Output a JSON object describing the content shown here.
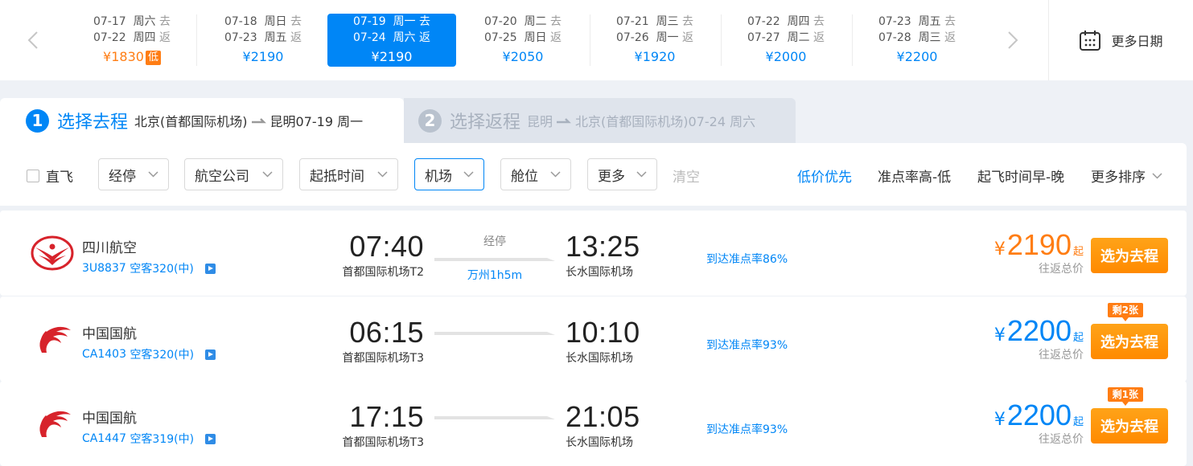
{
  "date_strip": {
    "items": [
      {
        "go_date": "07-17",
        "go_weekday": "周六",
        "go_dir": "去",
        "back_date": "07-22",
        "back_weekday": "周四",
        "back_dir": "返",
        "price": "¥1830",
        "low_tag": "低"
      },
      {
        "go_date": "07-18",
        "go_weekday": "周日",
        "go_dir": "去",
        "back_date": "07-23",
        "back_weekday": "周五",
        "back_dir": "返",
        "price": "¥2190"
      },
      {
        "go_date": "07-19",
        "go_weekday": "周一",
        "go_dir": "去",
        "back_date": "07-24",
        "back_weekday": "周六",
        "back_dir": "返",
        "price": "¥2190",
        "selected": true
      },
      {
        "go_date": "07-20",
        "go_weekday": "周二",
        "go_dir": "去",
        "back_date": "07-25",
        "back_weekday": "周日",
        "back_dir": "返",
        "price": "¥2050"
      },
      {
        "go_date": "07-21",
        "go_weekday": "周三",
        "go_dir": "去",
        "back_date": "07-26",
        "back_weekday": "周一",
        "back_dir": "返",
        "price": "¥1920"
      },
      {
        "go_date": "07-22",
        "go_weekday": "周四",
        "go_dir": "去",
        "back_date": "07-27",
        "back_weekday": "周二",
        "back_dir": "返",
        "price": "¥2000"
      },
      {
        "go_date": "07-23",
        "go_weekday": "周五",
        "go_dir": "去",
        "back_date": "07-28",
        "back_weekday": "周三",
        "back_dir": "返",
        "price": "¥2200"
      }
    ],
    "more_dates_label": "更多日期"
  },
  "steps": {
    "go": {
      "num": "1",
      "title": "选择去程",
      "from": "北京(首都国际机场)",
      "to": "昆明07-19 周一"
    },
    "back": {
      "num": "2",
      "title": "选择返程",
      "from": "昆明",
      "to": "北京(首都国际机场)07-24 周六"
    }
  },
  "filters": {
    "direct_label": "直飞",
    "buttons": [
      "经停",
      "航空公司",
      "起抵时间",
      "机场",
      "舱位",
      "更多"
    ],
    "active_button": "机场",
    "clear_label": "清空",
    "sorts": [
      "低价优先",
      "准点率高-低",
      "起飞时间早-晚",
      "更多排序"
    ],
    "active_sort": "低价优先"
  },
  "flights": [
    {
      "airline": "四川航空",
      "flight_no": "3U8837",
      "aircraft": "空客320(中)",
      "dep_time": "07:40",
      "dep_airport": "首都国际机场T2",
      "arr_time": "13:25",
      "arr_airport": "长水国际机场",
      "stop_label": "经停",
      "stop_city": "万州1h5m",
      "ontime": "到达准点率86%",
      "price_yen": "¥",
      "price": "2190",
      "price_qi": "起",
      "price_sub": "往返总价",
      "select_label": "选为去程"
    },
    {
      "airline": "中国国航",
      "flight_no": "CA1403",
      "aircraft": "空客320(中)",
      "dep_time": "06:15",
      "dep_airport": "首都国际机场T3",
      "arr_time": "10:10",
      "arr_airport": "长水国际机场",
      "ontime": "到达准点率93%",
      "price_yen": "¥",
      "price": "2200",
      "price_qi": "起",
      "price_sub": "往返总价",
      "remain": "剩2张",
      "select_label": "选为去程"
    },
    {
      "airline": "中国国航",
      "flight_no": "CA1447",
      "aircraft": "空客319(中)",
      "dep_time": "17:15",
      "dep_airport": "首都国际机场T3",
      "arr_time": "21:05",
      "arr_airport": "长水国际机场",
      "ontime": "到达准点率93%",
      "price_yen": "¥",
      "price": "2200",
      "price_qi": "起",
      "price_sub": "往返总价",
      "remain": "剩1张",
      "select_label": "选为去程"
    }
  ],
  "colors": {
    "accent": "#0086f6",
    "orange": "#ff7d13",
    "button_orange": "#ff8a00"
  }
}
